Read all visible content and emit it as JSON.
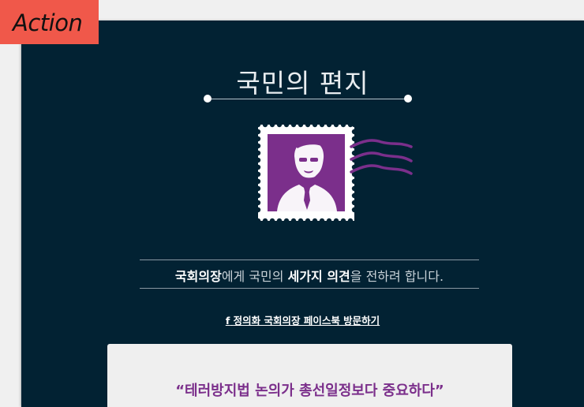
{
  "badge": {
    "label": "Action"
  },
  "letter": {
    "title": "국민의 편지",
    "subtitle": {
      "part1": "국회의장",
      "part2": "에게 국민의 ",
      "part3": "세가지 의견",
      "part4": "을 전하려 합니다."
    },
    "facebook_link": "정의화 국회의장 페이스북 방문하기",
    "facebook_icon": "f",
    "quote": "“테러방지법 논의가 총선일정보다 중요하다”"
  },
  "colors": {
    "background": "#022233",
    "badge": "#f0584a",
    "stamp": "#7b2f8b",
    "postmark": "#7b2f8b",
    "quote": "#7b2f8b"
  },
  "icons": {
    "stamp": "postage-stamp-icon",
    "postmark": "postmark-wave-icon",
    "facebook": "facebook-icon"
  }
}
